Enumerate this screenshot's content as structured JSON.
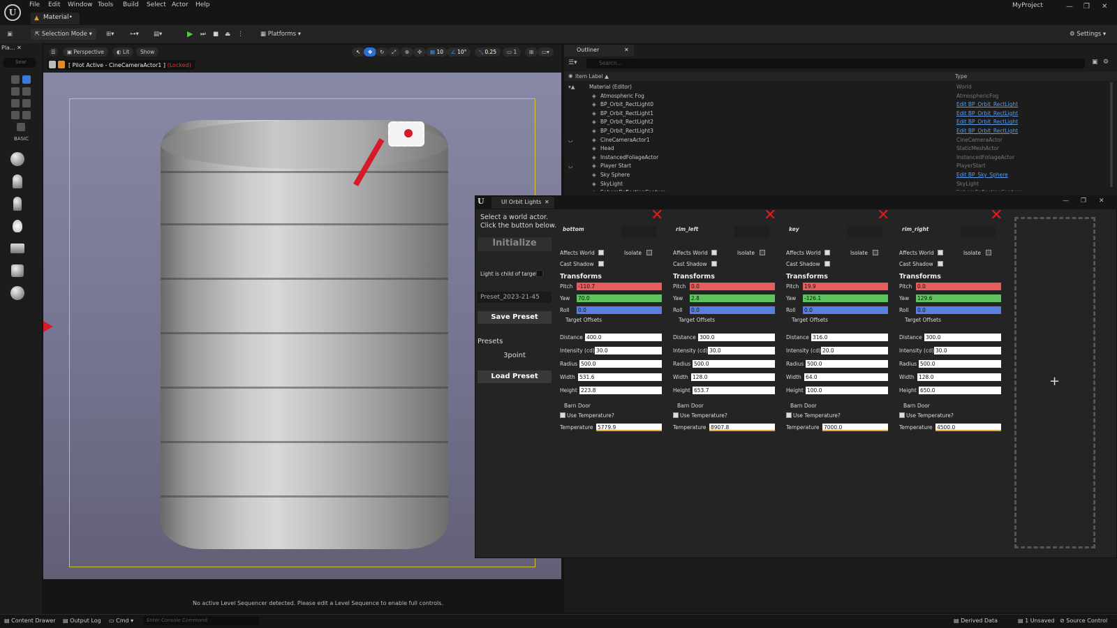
{
  "app": {
    "menus": [
      "File",
      "Edit",
      "Window",
      "Tools",
      "Build",
      "Select",
      "Actor",
      "Help"
    ],
    "project": "MyProject",
    "doc_tab": "Material•",
    "window_controls": [
      "—",
      "❐",
      "✕"
    ]
  },
  "toolbar": {
    "mode": "Selection Mode",
    "platforms": "Platforms",
    "settings": "Settings"
  },
  "left_panel": {
    "tab": "Pla...",
    "search_placeholder": "Sear",
    "basic": "BASIC"
  },
  "viewport": {
    "perspective": "Perspective",
    "lit": "Lit",
    "show": "Show",
    "grid": "10",
    "angle": "10°",
    "scale": "0.25",
    "cam": "1",
    "pilot": "[ Pilot Active - CineCameraActor1 ]",
    "locked": "(Locked)",
    "message": "No active Level Sequencer detected. Please edit a Level Sequence to enable full controls."
  },
  "outliner": {
    "tab": "Outliner",
    "search_placeholder": "Search...",
    "col_label": "Item Label ▲",
    "col_type": "Type",
    "rows": [
      {
        "label": "Material (Editor)",
        "type": "World",
        "link": false
      },
      {
        "label": "Atmospheric Fog",
        "type": "AtmosphericFog",
        "link": false
      },
      {
        "label": "BP_Orbit_RectLight0",
        "type": "Edit BP_Orbit_RectLight",
        "link": true
      },
      {
        "label": "BP_Orbit_RectLight1",
        "type": "Edit BP_Orbit_RectLight",
        "link": true
      },
      {
        "label": "BP_Orbit_RectLight2",
        "type": "Edit BP_Orbit_RectLight",
        "link": true
      },
      {
        "label": "BP_Orbit_RectLight3",
        "type": "Edit BP_Orbit_RectLight",
        "link": true
      },
      {
        "label": "CineCameraActor1",
        "type": "CineCameraActor",
        "link": false
      },
      {
        "label": "Head",
        "type": "StaticMeshActor",
        "link": false
      },
      {
        "label": "InstancedFoliageActor",
        "type": "InstancedFoliageActor",
        "link": false
      },
      {
        "label": "Player Start",
        "type": "PlayerStart",
        "link": false
      },
      {
        "label": "Sky Sphere",
        "type": "Edit BP_Sky_Sphere",
        "link": true
      },
      {
        "label": "SkyLight",
        "type": "SkyLight",
        "link": false
      },
      {
        "label": "SphereReflectionCapture",
        "type": "SphereReflectionCapture",
        "link": false
      }
    ]
  },
  "plugin": {
    "tab": "UI Orbit Lights",
    "instruction1": "Select a world actor.",
    "instruction2": "Click the button below.",
    "initialize": "Initialize",
    "child_label": "Light is child of target",
    "preset_name": "Preset_2023-21-45",
    "save_preset": "Save Preset",
    "presets_label": "Presets",
    "preset_item": "3point",
    "load_preset": "Load Preset",
    "labels": {
      "affects_world": "Affects World",
      "isolate": "Isolate",
      "cast_shadow": "Cast Shadow",
      "transforms": "Transforms",
      "pitch": "Pitch",
      "yaw": "Yaw",
      "roll": "Roll",
      "target_offsets": "Target Offsets",
      "distance": "Distance",
      "intensity": "Intensity (cd)",
      "radius": "Radius",
      "width": "Width",
      "height": "Height",
      "barn_door": "Barn Door",
      "use_temp": "Use Temperature?",
      "temperature": "Temperature"
    },
    "lights": [
      {
        "name": "bottom",
        "pitch": "-110.7",
        "yaw": "70.0",
        "roll": "0.0",
        "distance": "400.0",
        "intensity": "30.0",
        "radius": "500.0",
        "width": "531.6",
        "height": "223.8",
        "temperature": "5779.9"
      },
      {
        "name": "rim_left",
        "pitch": "0.0",
        "yaw": "2.8",
        "roll": "0.0",
        "distance": "300.0",
        "intensity": "30.0",
        "radius": "500.0",
        "width": "128.0",
        "height": "653.7",
        "temperature": "8907.8"
      },
      {
        "name": "key",
        "pitch": "19.9",
        "yaw": "-126.1",
        "roll": "0.0",
        "distance": "316.0",
        "intensity": "20.0",
        "radius": "500.0",
        "width": "64.0",
        "height": "100.0",
        "temperature": "7000.0"
      },
      {
        "name": "rim_right",
        "pitch": "0.0",
        "yaw": "129.6",
        "roll": "0.0",
        "distance": "300.0",
        "intensity": "30.0",
        "radius": "500.0",
        "width": "128.0",
        "height": "650.0",
        "temperature": "4500.0"
      }
    ],
    "add": "+"
  },
  "status": {
    "content_drawer": "Content Drawer",
    "output_log": "Output Log",
    "cmd": "Cmd",
    "console_placeholder": "Enter Console Command",
    "derived": "Derived Data",
    "unsaved": "1 Unsaved",
    "source": "Source Control"
  }
}
